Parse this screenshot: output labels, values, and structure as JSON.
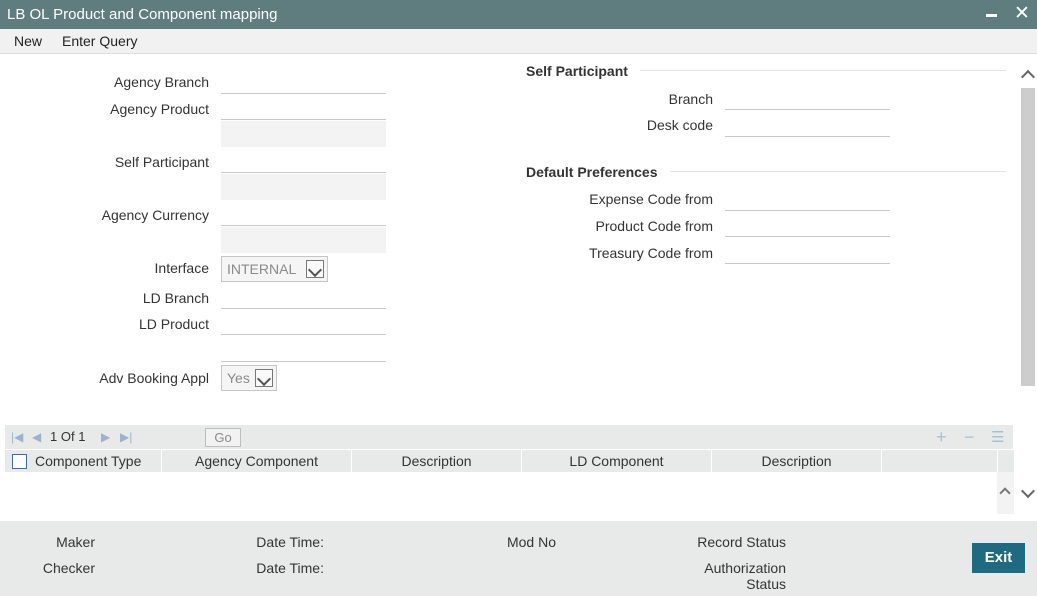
{
  "window": {
    "title": "LB OL Product and Component mapping"
  },
  "menu": {
    "items": [
      "New",
      "Enter Query"
    ]
  },
  "left_form": {
    "agency_branch_label": "Agency Branch",
    "agency_product_label": "Agency Product",
    "self_participant_label": "Self Participant",
    "agency_currency_label": "Agency Currency",
    "interface_label": "Interface",
    "interface_value": "INTERNAL",
    "ld_branch_label": "LD Branch",
    "ld_product_label": "LD Product",
    "adv_booking_label": "Adv Booking Appl",
    "adv_booking_value": "Yes"
  },
  "self_participant": {
    "title": "Self Participant",
    "branch_label": "Branch",
    "desk_code_label": "Desk code"
  },
  "default_preferences": {
    "title": "Default Preferences",
    "expense_label": "Expense Code from",
    "product_label": "Product Code from",
    "treasury_label": "Treasury Code from"
  },
  "grid": {
    "page_current": "1",
    "page_of": "Of",
    "page_total": "1",
    "go_label": "Go",
    "columns": [
      "Component Type",
      "Agency Component",
      "Description",
      "LD Component",
      "Description"
    ]
  },
  "footer": {
    "maker_label": "Maker",
    "checker_label": "Checker",
    "date_time_label_1": "Date Time:",
    "date_time_label_2": "Date Time:",
    "mod_no_label": "Mod No",
    "record_status_label": "Record Status",
    "auth_status_label_1": "Authorization",
    "auth_status_label_2": "Status",
    "exit_label": "Exit"
  }
}
